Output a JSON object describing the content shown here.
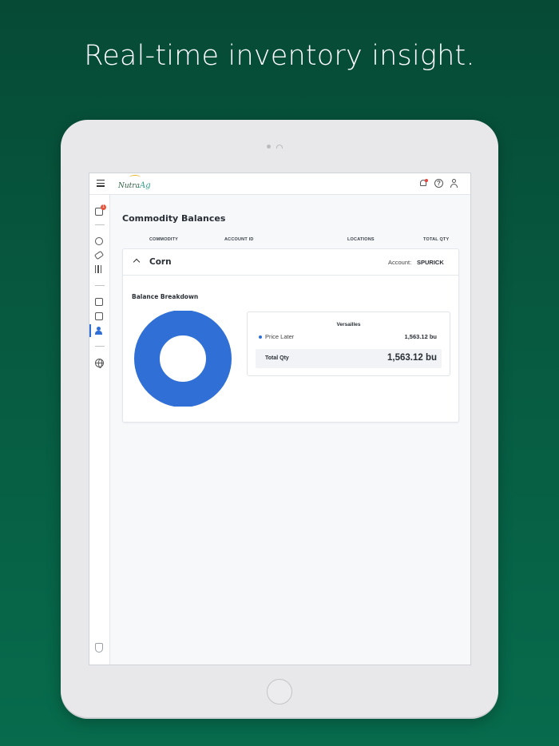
{
  "headline": "Real-time inventory insight.",
  "app": {
    "logo_text": "Nutra",
    "logo_suffix": "Ag",
    "notifications_badge": "1"
  },
  "page": {
    "title": "Commodity Balances",
    "columns": [
      "COMMODITY",
      "ACCOUNT ID",
      "LOCATIONS",
      "TOTAL QTY"
    ]
  },
  "commodity": {
    "name": "Corn",
    "account_label": "Account:",
    "account_value": "SPURICK",
    "breakdown_title": "Balance Breakdown",
    "location": "Versailles",
    "items": [
      {
        "label": "Price Later",
        "value": "1,563.12 bu",
        "color": "#2f6fd6"
      }
    ],
    "total_label": "Total Qty",
    "total_value": "1,563.12 bu"
  },
  "colors": {
    "accent": "#2f6fd6",
    "badge": "#e8553e",
    "background": "#075a40"
  }
}
